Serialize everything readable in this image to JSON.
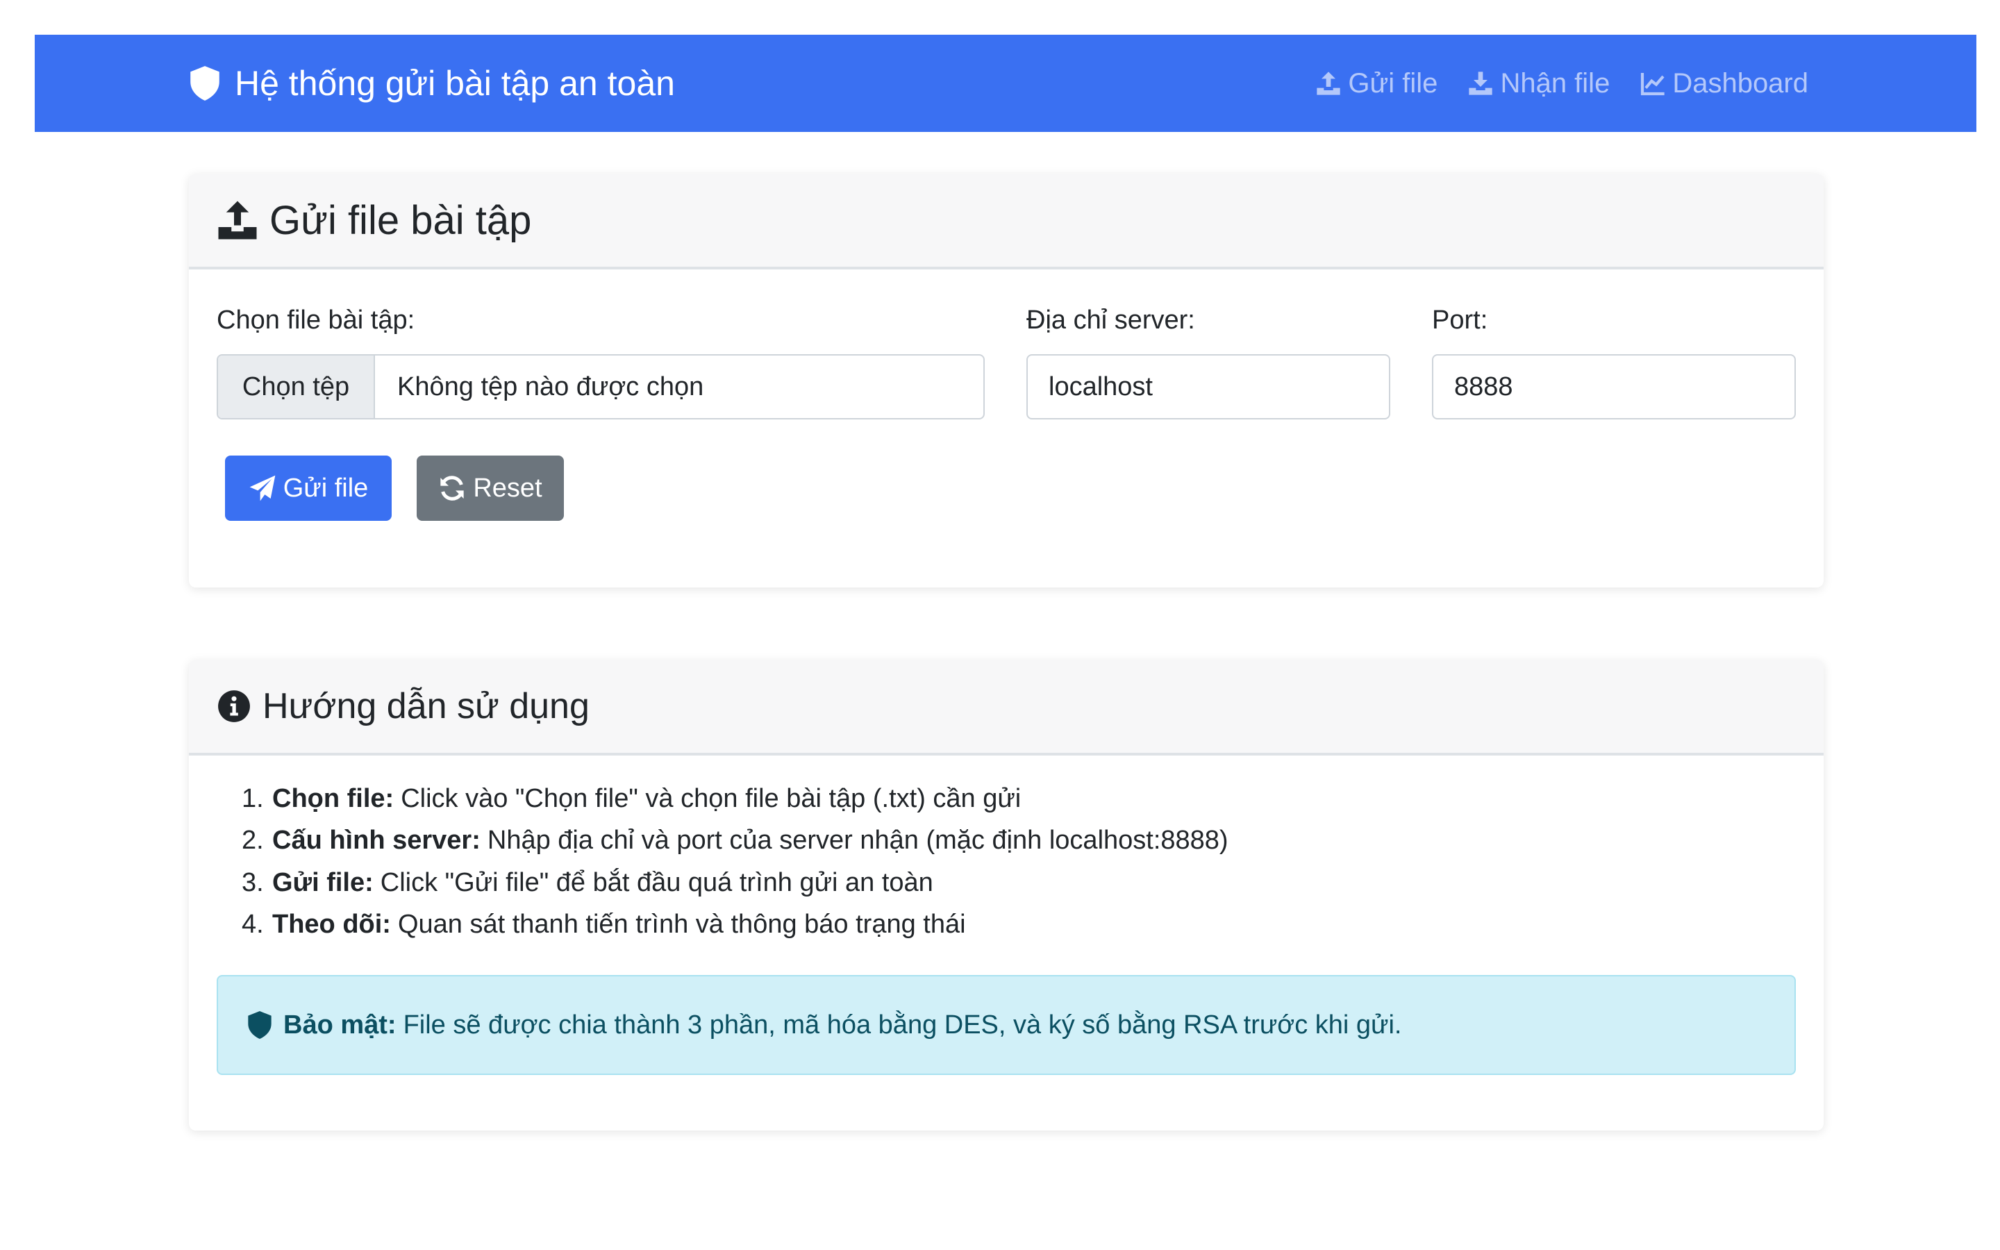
{
  "navbar": {
    "brand": "Hệ thống gửi bài tập an toàn",
    "links": [
      {
        "label": "Gửi file",
        "icon": "upload-icon"
      },
      {
        "label": "Nhận file",
        "icon": "download-icon"
      },
      {
        "label": "Dashboard",
        "icon": "chart-line-icon"
      }
    ]
  },
  "send_card": {
    "title": "Gửi file bài tập",
    "file_label": "Chọn file bài tập:",
    "file_button": "Chọn tệp",
    "file_status": "Không tệp nào được chọn",
    "server_label": "Địa chỉ server:",
    "server_value": "localhost",
    "port_label": "Port:",
    "port_value": "8888",
    "send_button": "Gửi file",
    "reset_button": "Reset"
  },
  "guide_card": {
    "title": "Hướng dẫn sử dụng",
    "steps": [
      {
        "num": "1.",
        "bold": "Chọn file:",
        "text": "Click vào \"Chọn file\" và chọn file bài tập (.txt) cần gửi"
      },
      {
        "num": "2.",
        "bold": "Cấu hình server:",
        "text": "Nhập địa chỉ và port của server nhận (mặc định localhost:8888)"
      },
      {
        "num": "3.",
        "bold": "Gửi file:",
        "text": "Click \"Gửi file\" để bắt đầu quá trình gửi an toàn"
      },
      {
        "num": "4.",
        "bold": "Theo dõi:",
        "text": "Quan sát thanh tiến trình và thông báo trạng thái"
      }
    ],
    "alert_bold": "Bảo mật:",
    "alert_text": "File sẽ được chia thành 3 phần, mã hóa bằng DES, và ký số bằng RSA trước khi gửi."
  },
  "colors": {
    "primary": "#3a70f2",
    "secondary": "#6c757d",
    "info_bg": "#d1f0f8",
    "info_text": "#0b4f61"
  }
}
